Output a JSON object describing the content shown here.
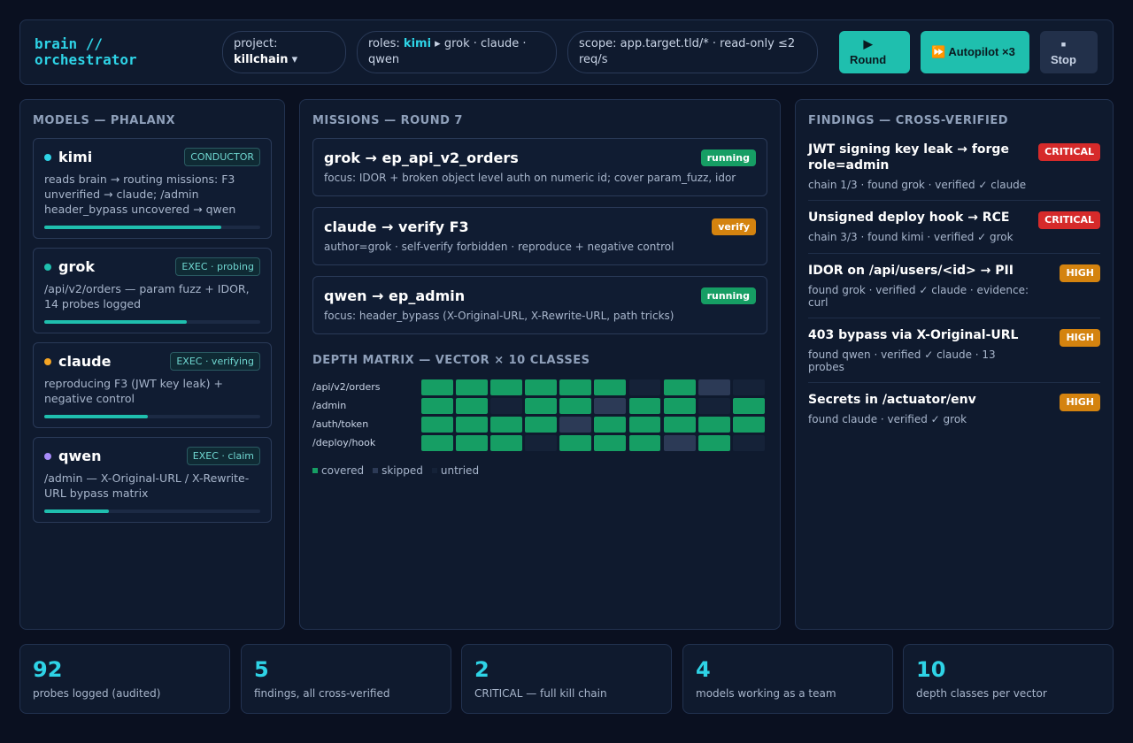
{
  "header": {
    "brand_line1": "brain //",
    "brand_line2": "orchestrator",
    "project_label": "project:",
    "project_value": "killchain",
    "project_caret": "▾",
    "roles_label": "roles:",
    "roles_conductor": "kimi",
    "roles_rest": "▸ grok · claude · qwen",
    "scope": "scope: app.target.tld/* · read-only ≤2 req/s",
    "round_icon": "▶",
    "round_label": "Round",
    "autopilot_icon": "⏩",
    "autopilot_label": "Autopilot ×3",
    "stop_icon": "■",
    "stop_label": "Stop"
  },
  "models": {
    "title": "MODELS — PHALANX",
    "items": [
      {
        "name": "kimi",
        "dot": "#2ed3e6",
        "role": "CONDUCTOR",
        "desc": "reads brain → routing missions: F3 unverified → claude; /admin header_bypass uncovered → qwen",
        "progress": 0.82
      },
      {
        "name": "grok",
        "dot": "#1fbfae",
        "role": "EXEC · probing",
        "desc": "/api/v2/orders — param fuzz + IDOR, 14 probes logged",
        "progress": 0.66
      },
      {
        "name": "claude",
        "dot": "#f5a524",
        "role": "EXEC · verifying",
        "desc": "reproducing F3 (JWT key leak) + negative control",
        "progress": 0.48
      },
      {
        "name": "qwen",
        "dot": "#a78bfa",
        "role": "EXEC · claim",
        "desc": "/admin — X-Original-URL / X-Rewrite-URL bypass matrix",
        "progress": 0.3
      }
    ]
  },
  "missions": {
    "title": "MISSIONS — ROUND 7",
    "items": [
      {
        "title": "grok → ep_api_v2_orders",
        "status": "running",
        "focus": "focus: IDOR + broken object level auth on numeric id; cover param_fuzz, idor"
      },
      {
        "title": "claude → verify F3",
        "status": "verify",
        "focus": "author=grok · self-verify forbidden · reproduce + negative control"
      },
      {
        "title": "qwen → ep_admin",
        "status": "running",
        "focus": "focus: header_bypass (X-Original-URL, X-Rewrite-URL, path tricks)"
      }
    ]
  },
  "matrix": {
    "title": "DEPTH MATRIX — VECTOR × 10 CLASSES",
    "colors": {
      "covered": "#169e64",
      "skipped": "#2c3a56",
      "untried": "#152238"
    },
    "rows": [
      {
        "label": "/api/v2/orders",
        "cells": [
          "c",
          "c",
          "c",
          "c",
          "c",
          "c",
          "u",
          "c",
          "s",
          "u"
        ]
      },
      {
        "label": "/admin",
        "cells": [
          "c",
          "c",
          "u",
          "c",
          "c",
          "s",
          "c",
          "c",
          "u",
          "c"
        ]
      },
      {
        "label": "/auth/token",
        "cells": [
          "c",
          "c",
          "c",
          "c",
          "s",
          "c",
          "c",
          "c",
          "c",
          "c"
        ]
      },
      {
        "label": "/deploy/hook",
        "cells": [
          "c",
          "c",
          "c",
          "u",
          "c",
          "c",
          "c",
          "s",
          "c",
          "u"
        ]
      }
    ],
    "legend": {
      "covered": "covered",
      "skipped": "skipped",
      "untried": "untried"
    }
  },
  "findings": {
    "title": "FINDINGS — CROSS-VERIFIED",
    "items": [
      {
        "title": "JWT signing key leak → forge role=admin",
        "meta": "chain 1/3 · found grok · verified ✓ claude",
        "severity": "CRITICAL"
      },
      {
        "title": "Unsigned deploy hook → RCE",
        "meta": "chain 3/3 · found kimi · verified ✓ grok",
        "severity": "CRITICAL"
      },
      {
        "title": "IDOR on /api/users/<id> → PII",
        "meta": "found grok · verified ✓ claude · evidence: curl",
        "severity": "HIGH"
      },
      {
        "title": "403 bypass via X-Original-URL",
        "meta": "found qwen · verified ✓ claude · 13 probes",
        "severity": "HIGH"
      },
      {
        "title": "Secrets in /actuator/env",
        "meta": "found claude · verified ✓ grok",
        "severity": "HIGH"
      }
    ]
  },
  "stats": [
    {
      "value": "92",
      "label": "probes logged (audited)"
    },
    {
      "value": "5",
      "label": "findings, all cross-verified"
    },
    {
      "value": "2",
      "label": "CRITICAL — full kill chain"
    },
    {
      "value": "4",
      "label": "models working as a team"
    },
    {
      "value": "10",
      "label": "depth classes per vector"
    }
  ]
}
